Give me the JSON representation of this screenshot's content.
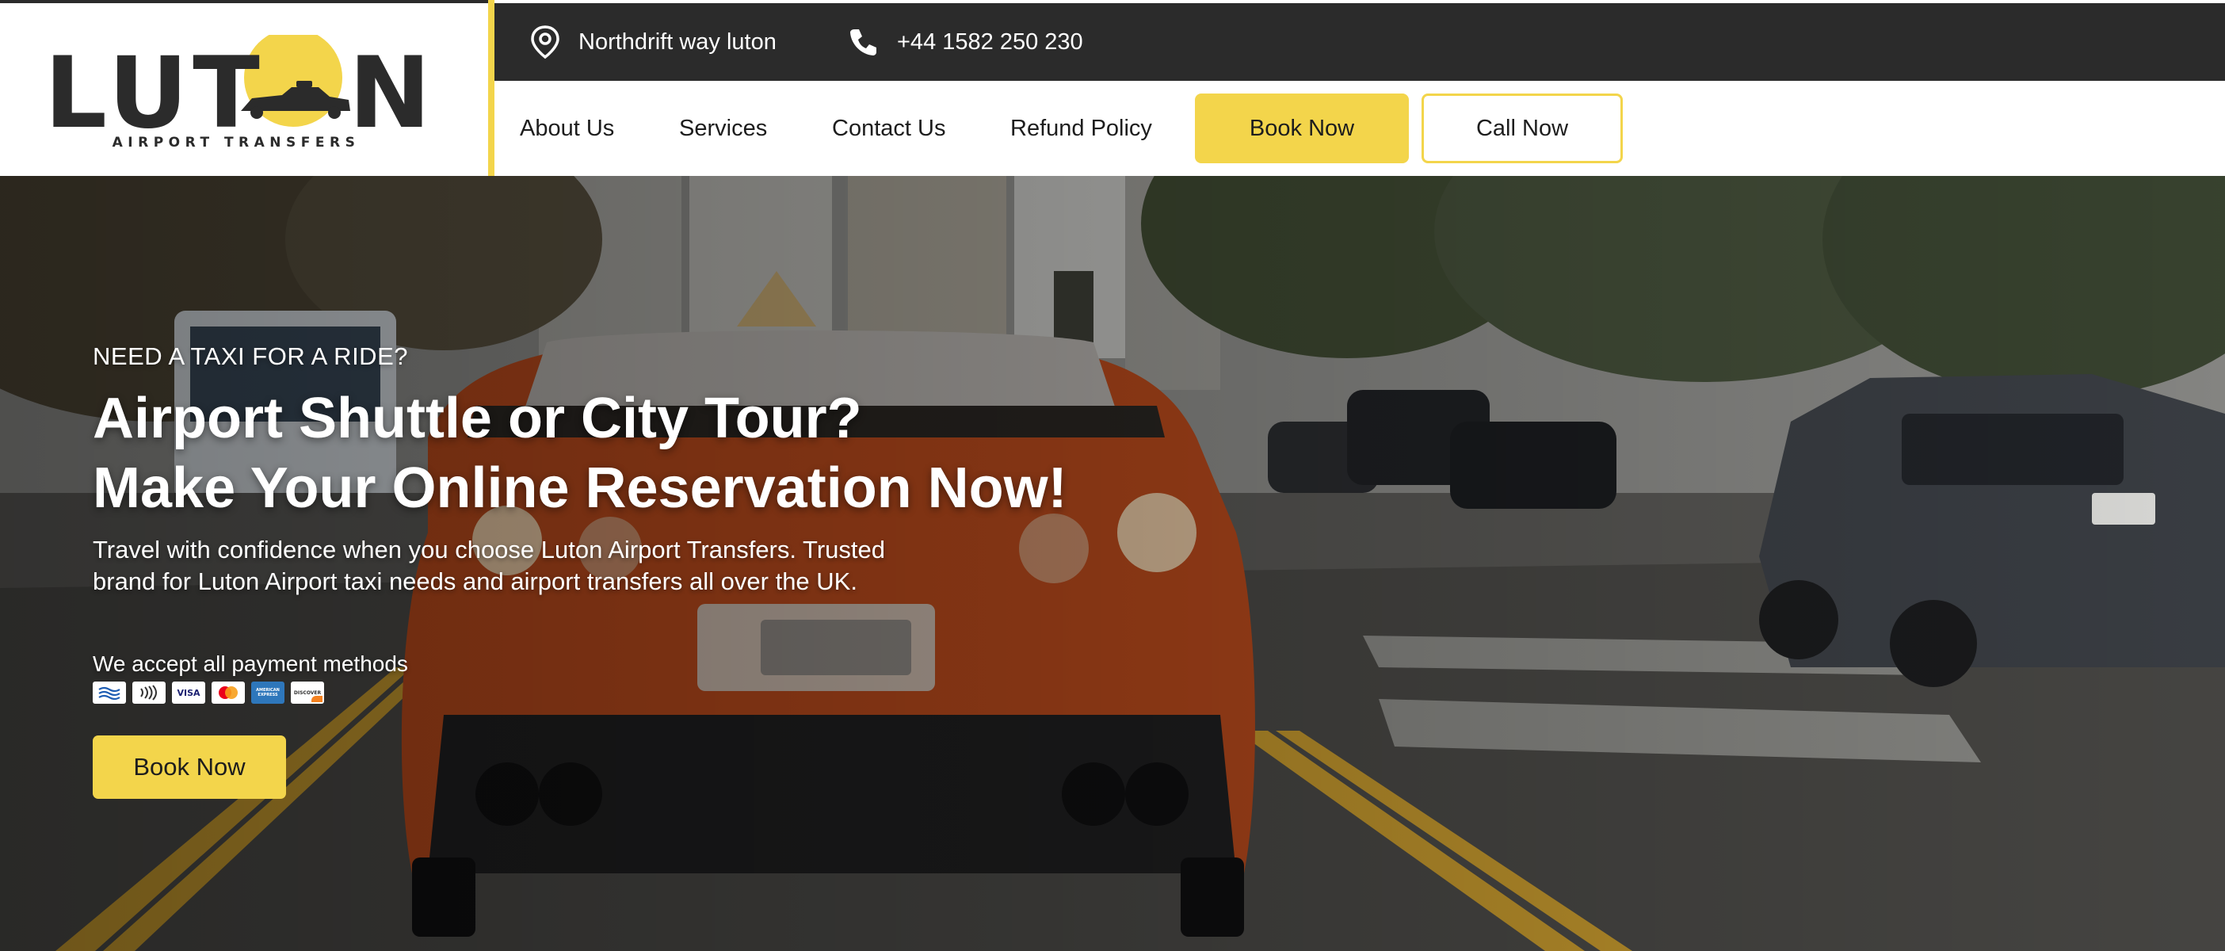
{
  "brand": {
    "name": "LUTON",
    "tagline": "AIRPORT TRANSFERS",
    "accent": "#f3d54b",
    "dark": "#2b2b2b"
  },
  "topbar": {
    "address": "Northdrift way luton",
    "address_icon": "location-pin-icon",
    "phone": "+44 1582 250 230",
    "phone_icon": "phone-icon"
  },
  "nav": {
    "items": [
      {
        "label": "About Us"
      },
      {
        "label": "Services"
      },
      {
        "label": "Contact Us"
      },
      {
        "label": "Refund Policy"
      }
    ],
    "book_label": "Book Now",
    "call_label": "Call Now"
  },
  "hero": {
    "kicker": "NEED A TAXI FOR A RIDE?",
    "headline_line1": "Airport Shuttle or City Tour?",
    "headline_line2": "Make Your Online Reservation Now!",
    "lead": "Travel with confidence when you choose Luton Airport Transfers. Trusted brand for Luton Airport taxi needs and airport transfers all over the UK.",
    "payment_label": "We accept all payment methods",
    "payment_cards": [
      "contactless-wave-icon",
      "nfc-icon",
      "visa-icon",
      "mastercard-icon",
      "amex-icon",
      "discover-icon"
    ],
    "visa_text": "VISA",
    "amex_text": "AMERICAN EXPRESS",
    "discover_text": "DISCOVER",
    "cta_label": "Book Now"
  }
}
